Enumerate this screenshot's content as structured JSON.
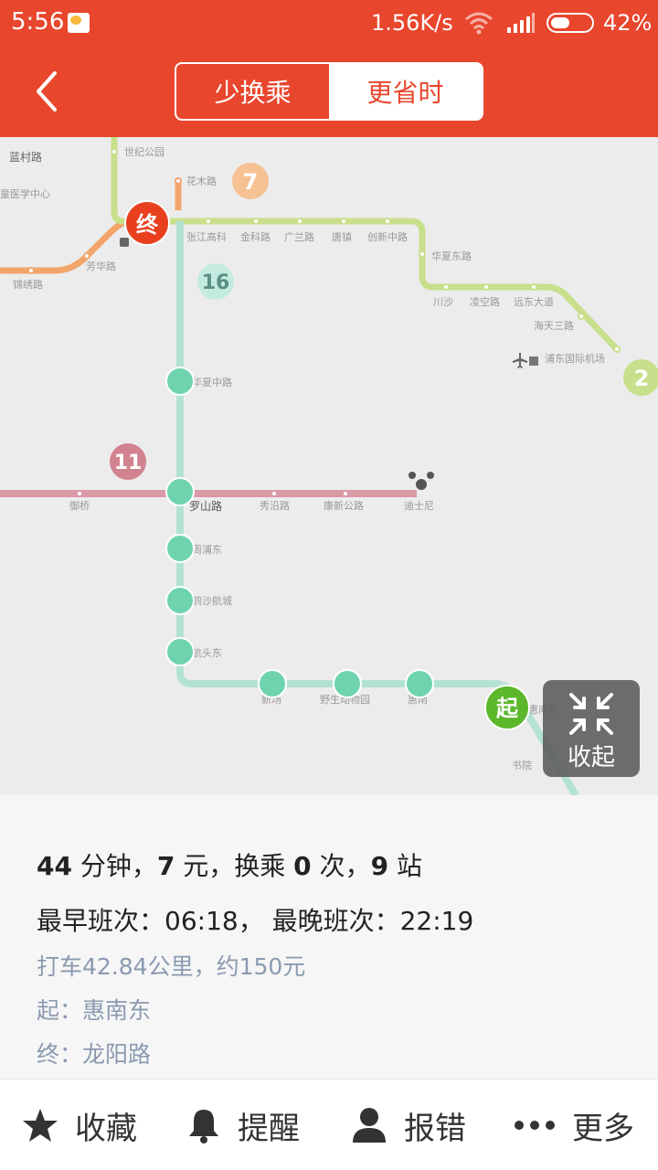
{
  "status": {
    "time": "5:56",
    "speed": "1.56K/s",
    "battery": "42%"
  },
  "header": {
    "back_icon": "chevron-left-icon",
    "tabs": [
      {
        "label": "少换乘",
        "selected": false
      },
      {
        "label": "更省时",
        "selected": true
      }
    ]
  },
  "map": {
    "labels": {
      "century_park": "世纪公园",
      "huamu_rd": "花木路",
      "lantern_rd": "蓝村路",
      "medical_center": "童医学中心",
      "fanghua_rd": "芳华路",
      "jinxiu_rd": "锦绣路",
      "zhangjiang": "张江高科",
      "jinke_rd": "金科路",
      "guanglan_rd": "广兰路",
      "tangzhen": "唐镇",
      "chuangxin_rd": "创新中路",
      "huaxia_east": "华夏东路",
      "chuansha": "川沙",
      "lingkong_rd": "凌空路",
      "yuandong_ave": "远东大道",
      "haitiansan_rd": "海天三路",
      "pudong_airport": "浦东国际机场",
      "huaxia_mid": "华夏中路",
      "yuqiao": "御桥",
      "luoshan_rd": "罗山路",
      "xiuyan_rd": "秀沿路",
      "kangxin_rd": "康新公路",
      "disney": "迪士尼",
      "zhoupu_east": "周浦东",
      "hesha": "鹤沙航城",
      "hangtou_east": "航头东",
      "xinchang": "新场",
      "wildlife_park": "野生动物园",
      "huinan": "惠南",
      "huinan_east": "惠南东",
      "shuyuan": "书院"
    },
    "line_numbers": {
      "line7": "7",
      "line16": "16",
      "line11": "11",
      "line2": "2"
    },
    "end_marker": "终",
    "start_marker": "起",
    "colors": {
      "line2": "#bcd97a",
      "line7": "#f2a56b",
      "line11": "#c9707f",
      "line16": "#a6dccc",
      "station": "#6fd3ae",
      "end_marker": "#e8401f",
      "start_marker": "#5cb82a"
    },
    "collapse": {
      "icon": "collapse-arrows-icon",
      "label": "收起"
    }
  },
  "info": {
    "duration_value": "44",
    "duration_unit": " 分钟，",
    "fare_value": "7",
    "fare_unit": " 元，换乘 ",
    "transfers_value": "0",
    "transfers_unit": " 次，",
    "stops_value": "9",
    "stops_unit": " 站",
    "schedule": "最早班次：06:18， 最晚班次：22:19",
    "taxi": "打车42.84公里，约150元",
    "start": "起：惠南东",
    "end": "终：龙阳路"
  },
  "bottom": {
    "items": [
      {
        "icon": "star-icon",
        "label": "收藏"
      },
      {
        "icon": "bell-icon",
        "label": "提醒"
      },
      {
        "icon": "person-icon",
        "label": "报错"
      },
      {
        "icon": "more-dots-icon",
        "label": "更多"
      }
    ]
  }
}
